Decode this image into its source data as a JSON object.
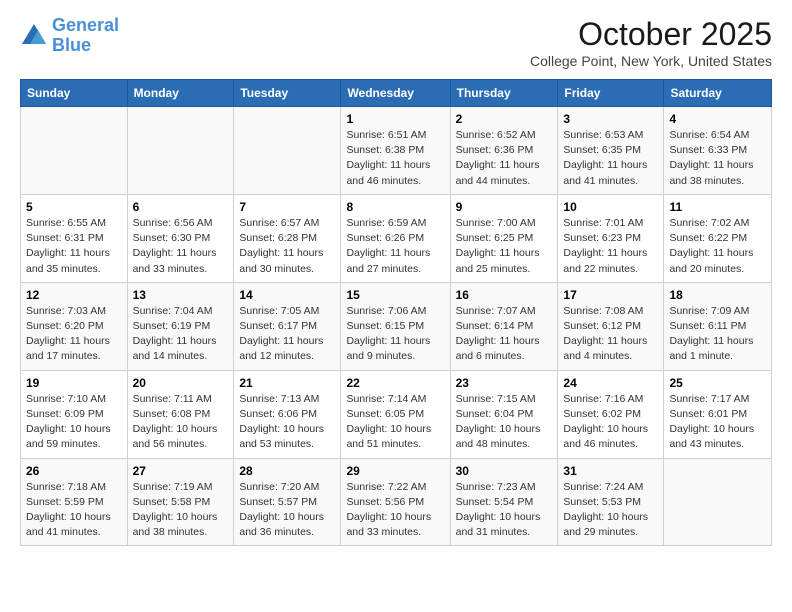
{
  "header": {
    "logo_line1": "General",
    "logo_line2": "Blue",
    "month": "October 2025",
    "location": "College Point, New York, United States"
  },
  "weekdays": [
    "Sunday",
    "Monday",
    "Tuesday",
    "Wednesday",
    "Thursday",
    "Friday",
    "Saturday"
  ],
  "weeks": [
    [
      {
        "day": "",
        "info": ""
      },
      {
        "day": "",
        "info": ""
      },
      {
        "day": "",
        "info": ""
      },
      {
        "day": "1",
        "info": "Sunrise: 6:51 AM\nSunset: 6:38 PM\nDaylight: 11 hours and 46 minutes."
      },
      {
        "day": "2",
        "info": "Sunrise: 6:52 AM\nSunset: 6:36 PM\nDaylight: 11 hours and 44 minutes."
      },
      {
        "day": "3",
        "info": "Sunrise: 6:53 AM\nSunset: 6:35 PM\nDaylight: 11 hours and 41 minutes."
      },
      {
        "day": "4",
        "info": "Sunrise: 6:54 AM\nSunset: 6:33 PM\nDaylight: 11 hours and 38 minutes."
      }
    ],
    [
      {
        "day": "5",
        "info": "Sunrise: 6:55 AM\nSunset: 6:31 PM\nDaylight: 11 hours and 35 minutes."
      },
      {
        "day": "6",
        "info": "Sunrise: 6:56 AM\nSunset: 6:30 PM\nDaylight: 11 hours and 33 minutes."
      },
      {
        "day": "7",
        "info": "Sunrise: 6:57 AM\nSunset: 6:28 PM\nDaylight: 11 hours and 30 minutes."
      },
      {
        "day": "8",
        "info": "Sunrise: 6:59 AM\nSunset: 6:26 PM\nDaylight: 11 hours and 27 minutes."
      },
      {
        "day": "9",
        "info": "Sunrise: 7:00 AM\nSunset: 6:25 PM\nDaylight: 11 hours and 25 minutes."
      },
      {
        "day": "10",
        "info": "Sunrise: 7:01 AM\nSunset: 6:23 PM\nDaylight: 11 hours and 22 minutes."
      },
      {
        "day": "11",
        "info": "Sunrise: 7:02 AM\nSunset: 6:22 PM\nDaylight: 11 hours and 20 minutes."
      }
    ],
    [
      {
        "day": "12",
        "info": "Sunrise: 7:03 AM\nSunset: 6:20 PM\nDaylight: 11 hours and 17 minutes."
      },
      {
        "day": "13",
        "info": "Sunrise: 7:04 AM\nSunset: 6:19 PM\nDaylight: 11 hours and 14 minutes."
      },
      {
        "day": "14",
        "info": "Sunrise: 7:05 AM\nSunset: 6:17 PM\nDaylight: 11 hours and 12 minutes."
      },
      {
        "day": "15",
        "info": "Sunrise: 7:06 AM\nSunset: 6:15 PM\nDaylight: 11 hours and 9 minutes."
      },
      {
        "day": "16",
        "info": "Sunrise: 7:07 AM\nSunset: 6:14 PM\nDaylight: 11 hours and 6 minutes."
      },
      {
        "day": "17",
        "info": "Sunrise: 7:08 AM\nSunset: 6:12 PM\nDaylight: 11 hours and 4 minutes."
      },
      {
        "day": "18",
        "info": "Sunrise: 7:09 AM\nSunset: 6:11 PM\nDaylight: 11 hours and 1 minute."
      }
    ],
    [
      {
        "day": "19",
        "info": "Sunrise: 7:10 AM\nSunset: 6:09 PM\nDaylight: 10 hours and 59 minutes."
      },
      {
        "day": "20",
        "info": "Sunrise: 7:11 AM\nSunset: 6:08 PM\nDaylight: 10 hours and 56 minutes."
      },
      {
        "day": "21",
        "info": "Sunrise: 7:13 AM\nSunset: 6:06 PM\nDaylight: 10 hours and 53 minutes."
      },
      {
        "day": "22",
        "info": "Sunrise: 7:14 AM\nSunset: 6:05 PM\nDaylight: 10 hours and 51 minutes."
      },
      {
        "day": "23",
        "info": "Sunrise: 7:15 AM\nSunset: 6:04 PM\nDaylight: 10 hours and 48 minutes."
      },
      {
        "day": "24",
        "info": "Sunrise: 7:16 AM\nSunset: 6:02 PM\nDaylight: 10 hours and 46 minutes."
      },
      {
        "day": "25",
        "info": "Sunrise: 7:17 AM\nSunset: 6:01 PM\nDaylight: 10 hours and 43 minutes."
      }
    ],
    [
      {
        "day": "26",
        "info": "Sunrise: 7:18 AM\nSunset: 5:59 PM\nDaylight: 10 hours and 41 minutes."
      },
      {
        "day": "27",
        "info": "Sunrise: 7:19 AM\nSunset: 5:58 PM\nDaylight: 10 hours and 38 minutes."
      },
      {
        "day": "28",
        "info": "Sunrise: 7:20 AM\nSunset: 5:57 PM\nDaylight: 10 hours and 36 minutes."
      },
      {
        "day": "29",
        "info": "Sunrise: 7:22 AM\nSunset: 5:56 PM\nDaylight: 10 hours and 33 minutes."
      },
      {
        "day": "30",
        "info": "Sunrise: 7:23 AM\nSunset: 5:54 PM\nDaylight: 10 hours and 31 minutes."
      },
      {
        "day": "31",
        "info": "Sunrise: 7:24 AM\nSunset: 5:53 PM\nDaylight: 10 hours and 29 minutes."
      },
      {
        "day": "",
        "info": ""
      }
    ]
  ]
}
